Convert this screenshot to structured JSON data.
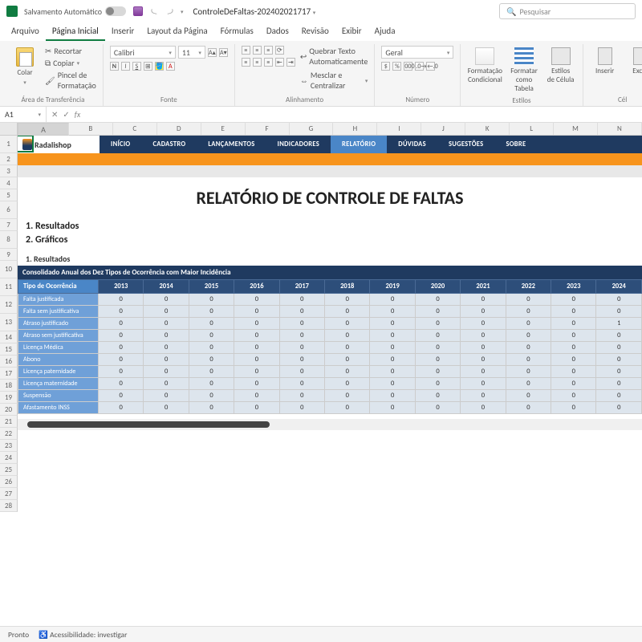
{
  "titlebar": {
    "autosave": "Salvamento Automático",
    "filename": "ControleDeFaltas-202402021717",
    "search": "Pesquisar"
  },
  "menus": [
    "Arquivo",
    "Página Inicial",
    "Inserir",
    "Layout da Página",
    "Fórmulas",
    "Dados",
    "Revisão",
    "Exibir",
    "Ajuda"
  ],
  "active_menu": 1,
  "ribbon": {
    "clipboard": {
      "paste": "Colar",
      "cut": "Recortar",
      "copy": "Copiar",
      "painter": "Pincel de Formatação",
      "label": "Área de Transferência"
    },
    "font": {
      "name": "Calibri",
      "size": "11",
      "label": "Fonte"
    },
    "align": {
      "wrap": "Quebrar Texto Automaticamente",
      "merge": "Mesclar e Centralizar",
      "label": "Alinhamento"
    },
    "number": {
      "format": "Geral",
      "label": "Número"
    },
    "styles": {
      "cond": "Formatação Condicional",
      "table": "Formatar como Tabela",
      "cell": "Estilos de Célula",
      "label": "Estilos"
    },
    "cells": {
      "ins": "Inserir",
      "del": "Exclu",
      "label": "Cél"
    }
  },
  "namebox": "A1",
  "cols": [
    "A",
    "B",
    "C",
    "D",
    "E",
    "F",
    "G",
    "H",
    "I",
    "J",
    "K",
    "L",
    "M",
    "N"
  ],
  "rows": [
    1,
    2,
    3,
    4,
    5,
    6,
    7,
    8,
    9,
    10,
    11,
    12,
    13,
    14,
    15,
    16,
    17,
    18,
    19,
    20,
    21,
    22,
    23,
    24,
    25,
    26,
    27,
    28
  ],
  "logo": "Radalishop",
  "nav": [
    "INÍCIO",
    "CADASTRO",
    "LANÇAMENTOS",
    "INDICADORES",
    "RELATÓRIO",
    "DÚVIDAS",
    "SUGESTÕES",
    "SOBRE"
  ],
  "nav_active": 4,
  "report_title": "RELATÓRIO DE CONTROLE DE FALTAS",
  "toc": [
    "1. Resultados",
    "2. Gráficos"
  ],
  "section1": "1. Resultados",
  "table_title": "Consolidado Anual dos Dez Tipos de Ocorrência com Maior Incidência",
  "col_label": "Tipo de Ocorrência",
  "years": [
    "2013",
    "2014",
    "2015",
    "2016",
    "2017",
    "2018",
    "2019",
    "2020",
    "2021",
    "2022",
    "2023",
    "2024"
  ],
  "table_rows": [
    {
      "label": "Falta justificada",
      "v": [
        0,
        0,
        0,
        0,
        0,
        0,
        0,
        0,
        0,
        0,
        0,
        0
      ]
    },
    {
      "label": "Falta sem justificativa",
      "v": [
        0,
        0,
        0,
        0,
        0,
        0,
        0,
        0,
        0,
        0,
        0,
        0
      ]
    },
    {
      "label": "Atraso justificado",
      "v": [
        0,
        0,
        0,
        0,
        0,
        0,
        0,
        0,
        0,
        0,
        0,
        1
      ]
    },
    {
      "label": "Atraso sem justificativa",
      "v": [
        0,
        0,
        0,
        0,
        0,
        0,
        0,
        0,
        0,
        0,
        0,
        0
      ]
    },
    {
      "label": "Licença Médica",
      "v": [
        0,
        0,
        0,
        0,
        0,
        0,
        0,
        0,
        0,
        0,
        0,
        0
      ]
    },
    {
      "label": "Abono",
      "v": [
        0,
        0,
        0,
        0,
        0,
        0,
        0,
        0,
        0,
        0,
        0,
        0
      ]
    },
    {
      "label": "Licença paternidade",
      "v": [
        0,
        0,
        0,
        0,
        0,
        0,
        0,
        0,
        0,
        0,
        0,
        0
      ]
    },
    {
      "label": "Licença maternidade",
      "v": [
        0,
        0,
        0,
        0,
        0,
        0,
        0,
        0,
        0,
        0,
        0,
        0
      ]
    },
    {
      "label": "Suspensão",
      "v": [
        0,
        0,
        0,
        0,
        0,
        0,
        0,
        0,
        0,
        0,
        0,
        0
      ]
    },
    {
      "label": "Afastamento INSS",
      "v": [
        0,
        0,
        0,
        0,
        0,
        0,
        0,
        0,
        0,
        0,
        0,
        0
      ]
    }
  ],
  "status": {
    "ready": "Pronto",
    "access": "Acessibilidade: investigar"
  },
  "chart_data": {
    "type": "table",
    "title": "Consolidado Anual dos Dez Tipos de Ocorrência com Maior Incidência",
    "categories": [
      "2013",
      "2014",
      "2015",
      "2016",
      "2017",
      "2018",
      "2019",
      "2020",
      "2021",
      "2022",
      "2023",
      "2024"
    ],
    "series": [
      {
        "name": "Falta justificada",
        "values": [
          0,
          0,
          0,
          0,
          0,
          0,
          0,
          0,
          0,
          0,
          0,
          0
        ]
      },
      {
        "name": "Falta sem justificativa",
        "values": [
          0,
          0,
          0,
          0,
          0,
          0,
          0,
          0,
          0,
          0,
          0,
          0
        ]
      },
      {
        "name": "Atraso justificado",
        "values": [
          0,
          0,
          0,
          0,
          0,
          0,
          0,
          0,
          0,
          0,
          0,
          1
        ]
      },
      {
        "name": "Atraso sem justificativa",
        "values": [
          0,
          0,
          0,
          0,
          0,
          0,
          0,
          0,
          0,
          0,
          0,
          0
        ]
      },
      {
        "name": "Licença Médica",
        "values": [
          0,
          0,
          0,
          0,
          0,
          0,
          0,
          0,
          0,
          0,
          0,
          0
        ]
      },
      {
        "name": "Abono",
        "values": [
          0,
          0,
          0,
          0,
          0,
          0,
          0,
          0,
          0,
          0,
          0,
          0
        ]
      },
      {
        "name": "Licença paternidade",
        "values": [
          0,
          0,
          0,
          0,
          0,
          0,
          0,
          0,
          0,
          0,
          0,
          0
        ]
      },
      {
        "name": "Licença maternidade",
        "values": [
          0,
          0,
          0,
          0,
          0,
          0,
          0,
          0,
          0,
          0,
          0,
          0
        ]
      },
      {
        "name": "Suspensão",
        "values": [
          0,
          0,
          0,
          0,
          0,
          0,
          0,
          0,
          0,
          0,
          0,
          0
        ]
      },
      {
        "name": "Afastamento INSS",
        "values": [
          0,
          0,
          0,
          0,
          0,
          0,
          0,
          0,
          0,
          0,
          0,
          0
        ]
      }
    ]
  }
}
